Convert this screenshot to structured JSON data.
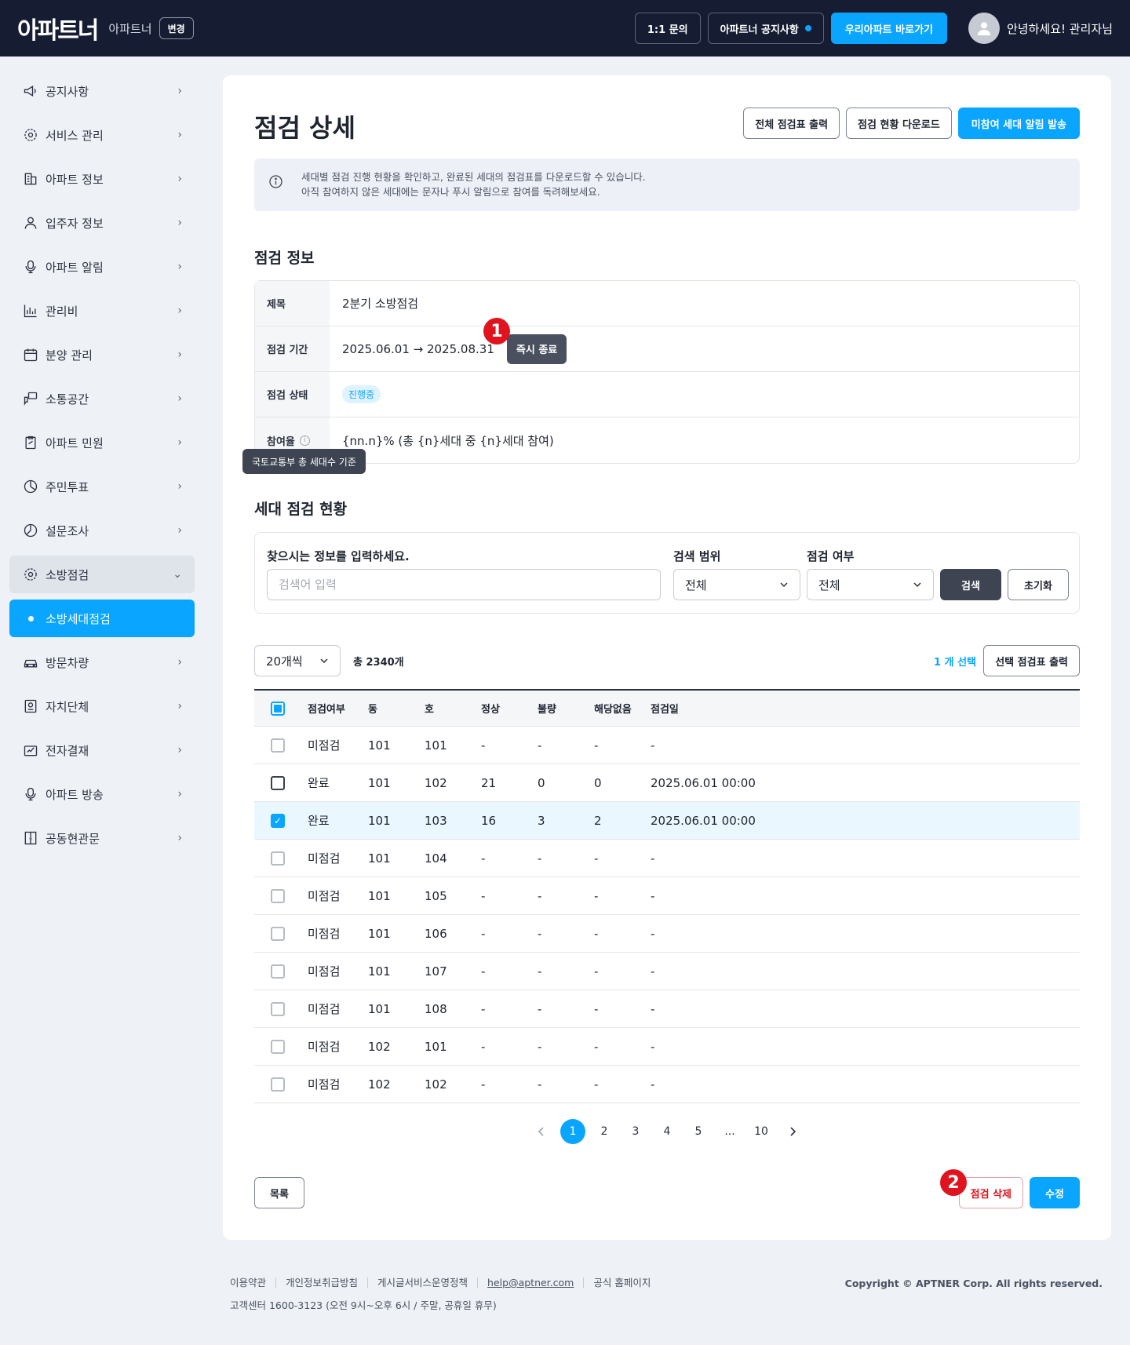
{
  "header": {
    "logo": "아파트너",
    "brand_sub": "아파트너",
    "change_label": "변경",
    "inquiry_label": "1:1 문의",
    "notice_label": "아파트너 공지사항",
    "shortcut_label": "우리아파트 바로가기",
    "greeting": "안녕하세요! 관리자님"
  },
  "sidebar": {
    "items": [
      {
        "label": "공지사항",
        "icon": "megaphone-icon"
      },
      {
        "label": "서비스 관리",
        "icon": "gear-icon"
      },
      {
        "label": "아파트 정보",
        "icon": "building-icon"
      },
      {
        "label": "입주자 정보",
        "icon": "person-icon"
      },
      {
        "label": "아파트 알림",
        "icon": "microphone-icon"
      },
      {
        "label": "관리비",
        "icon": "chart-icon"
      },
      {
        "label": "분양 관리",
        "icon": "calendar-icon"
      },
      {
        "label": "소통공간",
        "icon": "chat-icon"
      },
      {
        "label": "아파트 민원",
        "icon": "clipboard-icon"
      },
      {
        "label": "주민투표",
        "icon": "pie-icon"
      },
      {
        "label": "설문조사",
        "icon": "pie-icon"
      },
      {
        "label": "소방점검",
        "icon": "gear-icon"
      },
      {
        "label": "소방세대점검",
        "icon": "bullet"
      },
      {
        "label": "방문차량",
        "icon": "car-icon"
      },
      {
        "label": "자치단체",
        "icon": "id-card-icon"
      },
      {
        "label": "전자결재",
        "icon": "sign-icon"
      },
      {
        "label": "아파트 방송",
        "icon": "microphone-icon"
      },
      {
        "label": "공동현관문",
        "icon": "door-icon"
      }
    ]
  },
  "page": {
    "title": "점검 상세",
    "btn_print_all": "전체 점검표 출력",
    "btn_download": "점검 현황 다운로드",
    "btn_notify": "미참여 세대 알림 발송",
    "notice_line1": "세대별 점검 진행 현황을 확인하고, 완료된 세대의 점검표를 다운로드할 수 있습니다.",
    "notice_line2": "아직 참여하지 않은 세대에는 문자나 푸시 알림으로 참여를 독려해보세요."
  },
  "info": {
    "section_title": "점검 정보",
    "title_label": "제목",
    "title_value": "2분기 소방점검",
    "period_label": "점검 기간",
    "period_value": "2025.06.01 → 2025.08.31",
    "end_now_label": "즉시 종료",
    "status_label": "점검 상태",
    "status_value": "진행중",
    "rate_label": "참여율",
    "rate_value": "{nn.n}% (총 {n}세대 중 {n}세대 참여)",
    "rate_tooltip": "국토교통부 총 세대수 기준"
  },
  "markers": {
    "m1": "1",
    "m2": "2"
  },
  "search": {
    "section_title": "세대 점검 현황",
    "query_label": "찾으시는 정보를 입력하세요.",
    "query_placeholder": "검색어 입력",
    "range_label": "검색 범위",
    "range_value": "전체",
    "done_label": "점검 여부",
    "done_value": "전체",
    "search_btn": "검색",
    "reset_btn": "초기화"
  },
  "list": {
    "per_page": "20개씩",
    "total": "총 2340개",
    "selected_count": "1 개 선택",
    "print_selected": "선택 점검표 출력",
    "columns": [
      "점검여부",
      "동",
      "호",
      "정상",
      "불량",
      "해당없음",
      "점검일"
    ],
    "rows": [
      {
        "status": "미점검",
        "dong": "101",
        "ho": "101",
        "ok": "-",
        "bad": "-",
        "na": "-",
        "date": "-",
        "checked": false,
        "dark": false
      },
      {
        "status": "완료",
        "dong": "101",
        "ho": "102",
        "ok": "21",
        "bad": "0",
        "na": "0",
        "date": "2025.06.01 00:00",
        "checked": false,
        "dark": true
      },
      {
        "status": "완료",
        "dong": "101",
        "ho": "103",
        "ok": "16",
        "bad": "3",
        "na": "2",
        "date": "2025.06.01 00:00",
        "checked": true,
        "dark": false
      },
      {
        "status": "미점검",
        "dong": "101",
        "ho": "104",
        "ok": "-",
        "bad": "-",
        "na": "-",
        "date": "-",
        "checked": false,
        "dark": false
      },
      {
        "status": "미점검",
        "dong": "101",
        "ho": "105",
        "ok": "-",
        "bad": "-",
        "na": "-",
        "date": "-",
        "checked": false,
        "dark": false
      },
      {
        "status": "미점검",
        "dong": "101",
        "ho": "106",
        "ok": "-",
        "bad": "-",
        "na": "-",
        "date": "-",
        "checked": false,
        "dark": false
      },
      {
        "status": "미점검",
        "dong": "101",
        "ho": "107",
        "ok": "-",
        "bad": "-",
        "na": "-",
        "date": "-",
        "checked": false,
        "dark": false
      },
      {
        "status": "미점검",
        "dong": "101",
        "ho": "108",
        "ok": "-",
        "bad": "-",
        "na": "-",
        "date": "-",
        "checked": false,
        "dark": false
      },
      {
        "status": "미점검",
        "dong": "102",
        "ho": "101",
        "ok": "-",
        "bad": "-",
        "na": "-",
        "date": "-",
        "checked": false,
        "dark": false
      },
      {
        "status": "미점검",
        "dong": "102",
        "ho": "102",
        "ok": "-",
        "bad": "-",
        "na": "-",
        "date": "-",
        "checked": false,
        "dark": false
      }
    ]
  },
  "pagination": {
    "pages": [
      "1",
      "2",
      "3",
      "4",
      "5",
      "...",
      "10"
    ],
    "current": "1"
  },
  "actions": {
    "list_btn": "목록",
    "delete_btn": "점검 삭제",
    "edit_btn": "수정"
  },
  "footer": {
    "terms": "이용약관",
    "privacy": "개인정보취급방침",
    "post_policy": "게시글서비스운영정책",
    "email": "help@aptner.com",
    "homepage": "공식 홈페이지",
    "cs": "고객센터 1600-3123 (오전 9시~오후 6시 / 주말, 공휴일 휴무)",
    "copyright": "Copyright © APTNER Corp. All rights reserved."
  },
  "colors": {
    "accent": "#0aa5ff",
    "header_bg": "#161d33",
    "danger": "#e0141e"
  }
}
